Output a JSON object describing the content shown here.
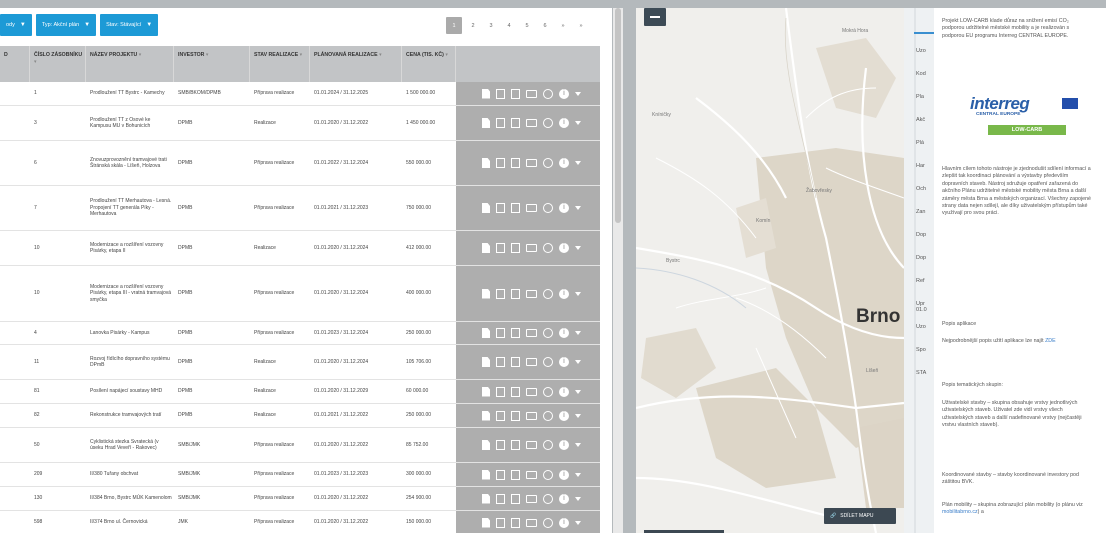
{
  "filters": [
    {
      "label": "ody"
    },
    {
      "label": "Typ: Akční plán"
    },
    {
      "label": "Stav: Stávající"
    }
  ],
  "pager": [
    "1",
    "2",
    "3",
    "4",
    "5",
    "6",
    "»",
    "»"
  ],
  "columns": [
    {
      "label": "D"
    },
    {
      "label": "ČÍSLO ZÁSOBNÍKU"
    },
    {
      "label": "NÁZEV PROJEKTU"
    },
    {
      "label": "INVESTOR"
    },
    {
      "label": "STAV REALIZACE"
    },
    {
      "label": "PLÁNOVANÁ REALIZACE"
    },
    {
      "label": "CENA (TIS. KČ)"
    }
  ],
  "rows": [
    {
      "id": "1",
      "name": "Prodloužení TT Bystrc - Kamechy",
      "investor": "SMB/BKOM/DPMB",
      "status": "Příprava realizace",
      "period": "01.01.2024 / 31.12.2025",
      "price": "1 500 000.00",
      "h": 24
    },
    {
      "id": "3",
      "name": "Prodloužení TT z Osové ke Kampusu MU v Bohunicích",
      "investor": "DPMB",
      "status": "Realizace",
      "period": "01.01.2020 / 31.12.2022",
      "price": "1 450 000.00",
      "h": 35
    },
    {
      "id": "6",
      "name": "Znovuzprovoznění tramvajové trati Štránská skála - Líšeň, Holzova",
      "investor": "DPMB",
      "status": "Příprava realizace",
      "period": "01.01.2022 / 31.12.2024",
      "price": "550 000.00",
      "h": 45
    },
    {
      "id": "7",
      "name": "Prodloužení TT Merhautova - Lesná. Propojení TT generála Píky - Merhautova",
      "investor": "DPMB",
      "status": "Příprava realizace",
      "period": "01.01.2021 / 31.12.2023",
      "price": "750 000.00",
      "h": 45
    },
    {
      "id": "10",
      "name": "Modernizace a rozšíření vozovny Pisárky, etapa II",
      "investor": "DPMB",
      "status": "Realizace",
      "period": "01.01.2020 / 31.12.2024",
      "price": "412 000.00",
      "h": 35
    },
    {
      "id": "10",
      "name": "Modernizace a rozšíření vozovny Pisárky, etapa III - vratná tramvajová smyčka",
      "investor": "DPMB",
      "status": "Příprava realizace",
      "period": "01.01.2020 / 31.12.2024",
      "price": "400 000.00",
      "h": 56
    },
    {
      "id": "4",
      "name": "Lanovka Pisárky - Kampus",
      "investor": "DPMB",
      "status": "Příprava realizace",
      "period": "01.01.2023 / 31.12.2024",
      "price": "250 000.00",
      "h": 23
    },
    {
      "id": "11",
      "name": "Rozvoj řídícího dopravního systému DPmB",
      "investor": "DPMB",
      "status": "Realizace",
      "period": "01.01.2020 / 31.12.2024",
      "price": "105 706.00",
      "h": 35
    },
    {
      "id": "81",
      "name": "Posílení napájecí soustavy MHD",
      "investor": "DPMB",
      "status": "Realizace",
      "period": "01.01.2020 / 31.12.2029",
      "price": "60 000.00",
      "h": 24
    },
    {
      "id": "82",
      "name": "Rekonstrukce tramvajových tratí",
      "investor": "DPMB",
      "status": "Realizace",
      "period": "01.01.2021 / 31.12.2022",
      "price": "250 000.00",
      "h": 24
    },
    {
      "id": "50",
      "name": "Cyklistická stezka Svratecká (v úseku Hrad Veveří - Rakovec)",
      "investor": "SMB/JMK",
      "status": "Příprava realizace",
      "period": "01.01.2020 / 31.12.2022",
      "price": "85 752.00",
      "h": 35
    },
    {
      "id": "209",
      "name": "II/380 Tuřany obchvat",
      "investor": "SMB/JMK",
      "status": "Příprava realizace",
      "period": "01.01.2023 / 31.12.2023",
      "price": "300 000.00",
      "h": 24
    },
    {
      "id": "130",
      "name": "II/384 Brno, Bystrc MÚK Kamenolom",
      "investor": "SMB/JMK",
      "status": "Příprava realizace",
      "period": "01.01.2020 / 31.12.2022",
      "price": "254 900.00",
      "h": 24
    },
    {
      "id": "598",
      "name": "II/374 Brno ul. Černovická",
      "investor": "JMK",
      "status": "Příprava realizace",
      "period": "01.01.2020 / 31.12.2022",
      "price": "150 000.00",
      "h": 24
    }
  ],
  "map": {
    "city": "Brno",
    "labels": [
      {
        "t": "Mokrá Hora"
      },
      {
        "t": "Kníničky"
      },
      {
        "t": "Bystrc"
      },
      {
        "t": "Komín"
      },
      {
        "t": "Žabovřesky"
      },
      {
        "t": "Líšeň"
      }
    ],
    "share_label": "SDÍLET MAPU"
  },
  "side": {
    "labels": [
      "Uzo",
      "Kod",
      "Pla",
      "Akč",
      "Plá",
      "Har",
      "Och",
      "Zan",
      "Dop",
      "Dop",
      "Ref",
      "Upr 01.0",
      "Uzo",
      "Spo",
      "STA"
    ]
  },
  "info": {
    "intro": "Projekt LOW-CARB klade důraz na snížení emisí CO₂ podporou udržitelné městské mobility a je realizován s podporou EU programu Interreg CENTRAL EUROPE.",
    "logo_brand": "interreg",
    "logo_sub": "CENTRAL EUROPE",
    "logo_badge": "LOW-CARB",
    "main": "Hlavním cílem tohoto nástroje je zjednodušit sdílení informací a zlepšit tak koordinaci plánování a výstavby především dopravních staveb. Nástroj sdružuje opatření zařazená do akčního Plánu udržitelné městské mobility města Brna a další záměry města Brna a městských organizací. Všechny zapojené strany data nejen sdílejí, ale díky uživatelským přístupům také využívají pro svou práci.",
    "app_title": "Popis aplikace",
    "app_text": "Nejpodrobnější popis užití aplikace lze najít ",
    "app_link": "ZDE",
    "groups_title": "Popis tematických skupin:",
    "groups_text": "Uživatelské stavby – skupina obsahuje vrstvy jednotlivých uživatelských staveb. Uživatel zde vidí vrstvy všech uživatelských staveb a další nadefinované vrstvy (nejčastěji vrstvu vlastních staveb).",
    "coord_text": "Koordinované stavby – stavby koordinované investory pod záštitou BVK.",
    "plan_text": "Plán mobility – skupina zobrazující plán mobility (o plánu viz ",
    "plan_link": "mobilitabrno.cz",
    "plan_end": ") a"
  }
}
